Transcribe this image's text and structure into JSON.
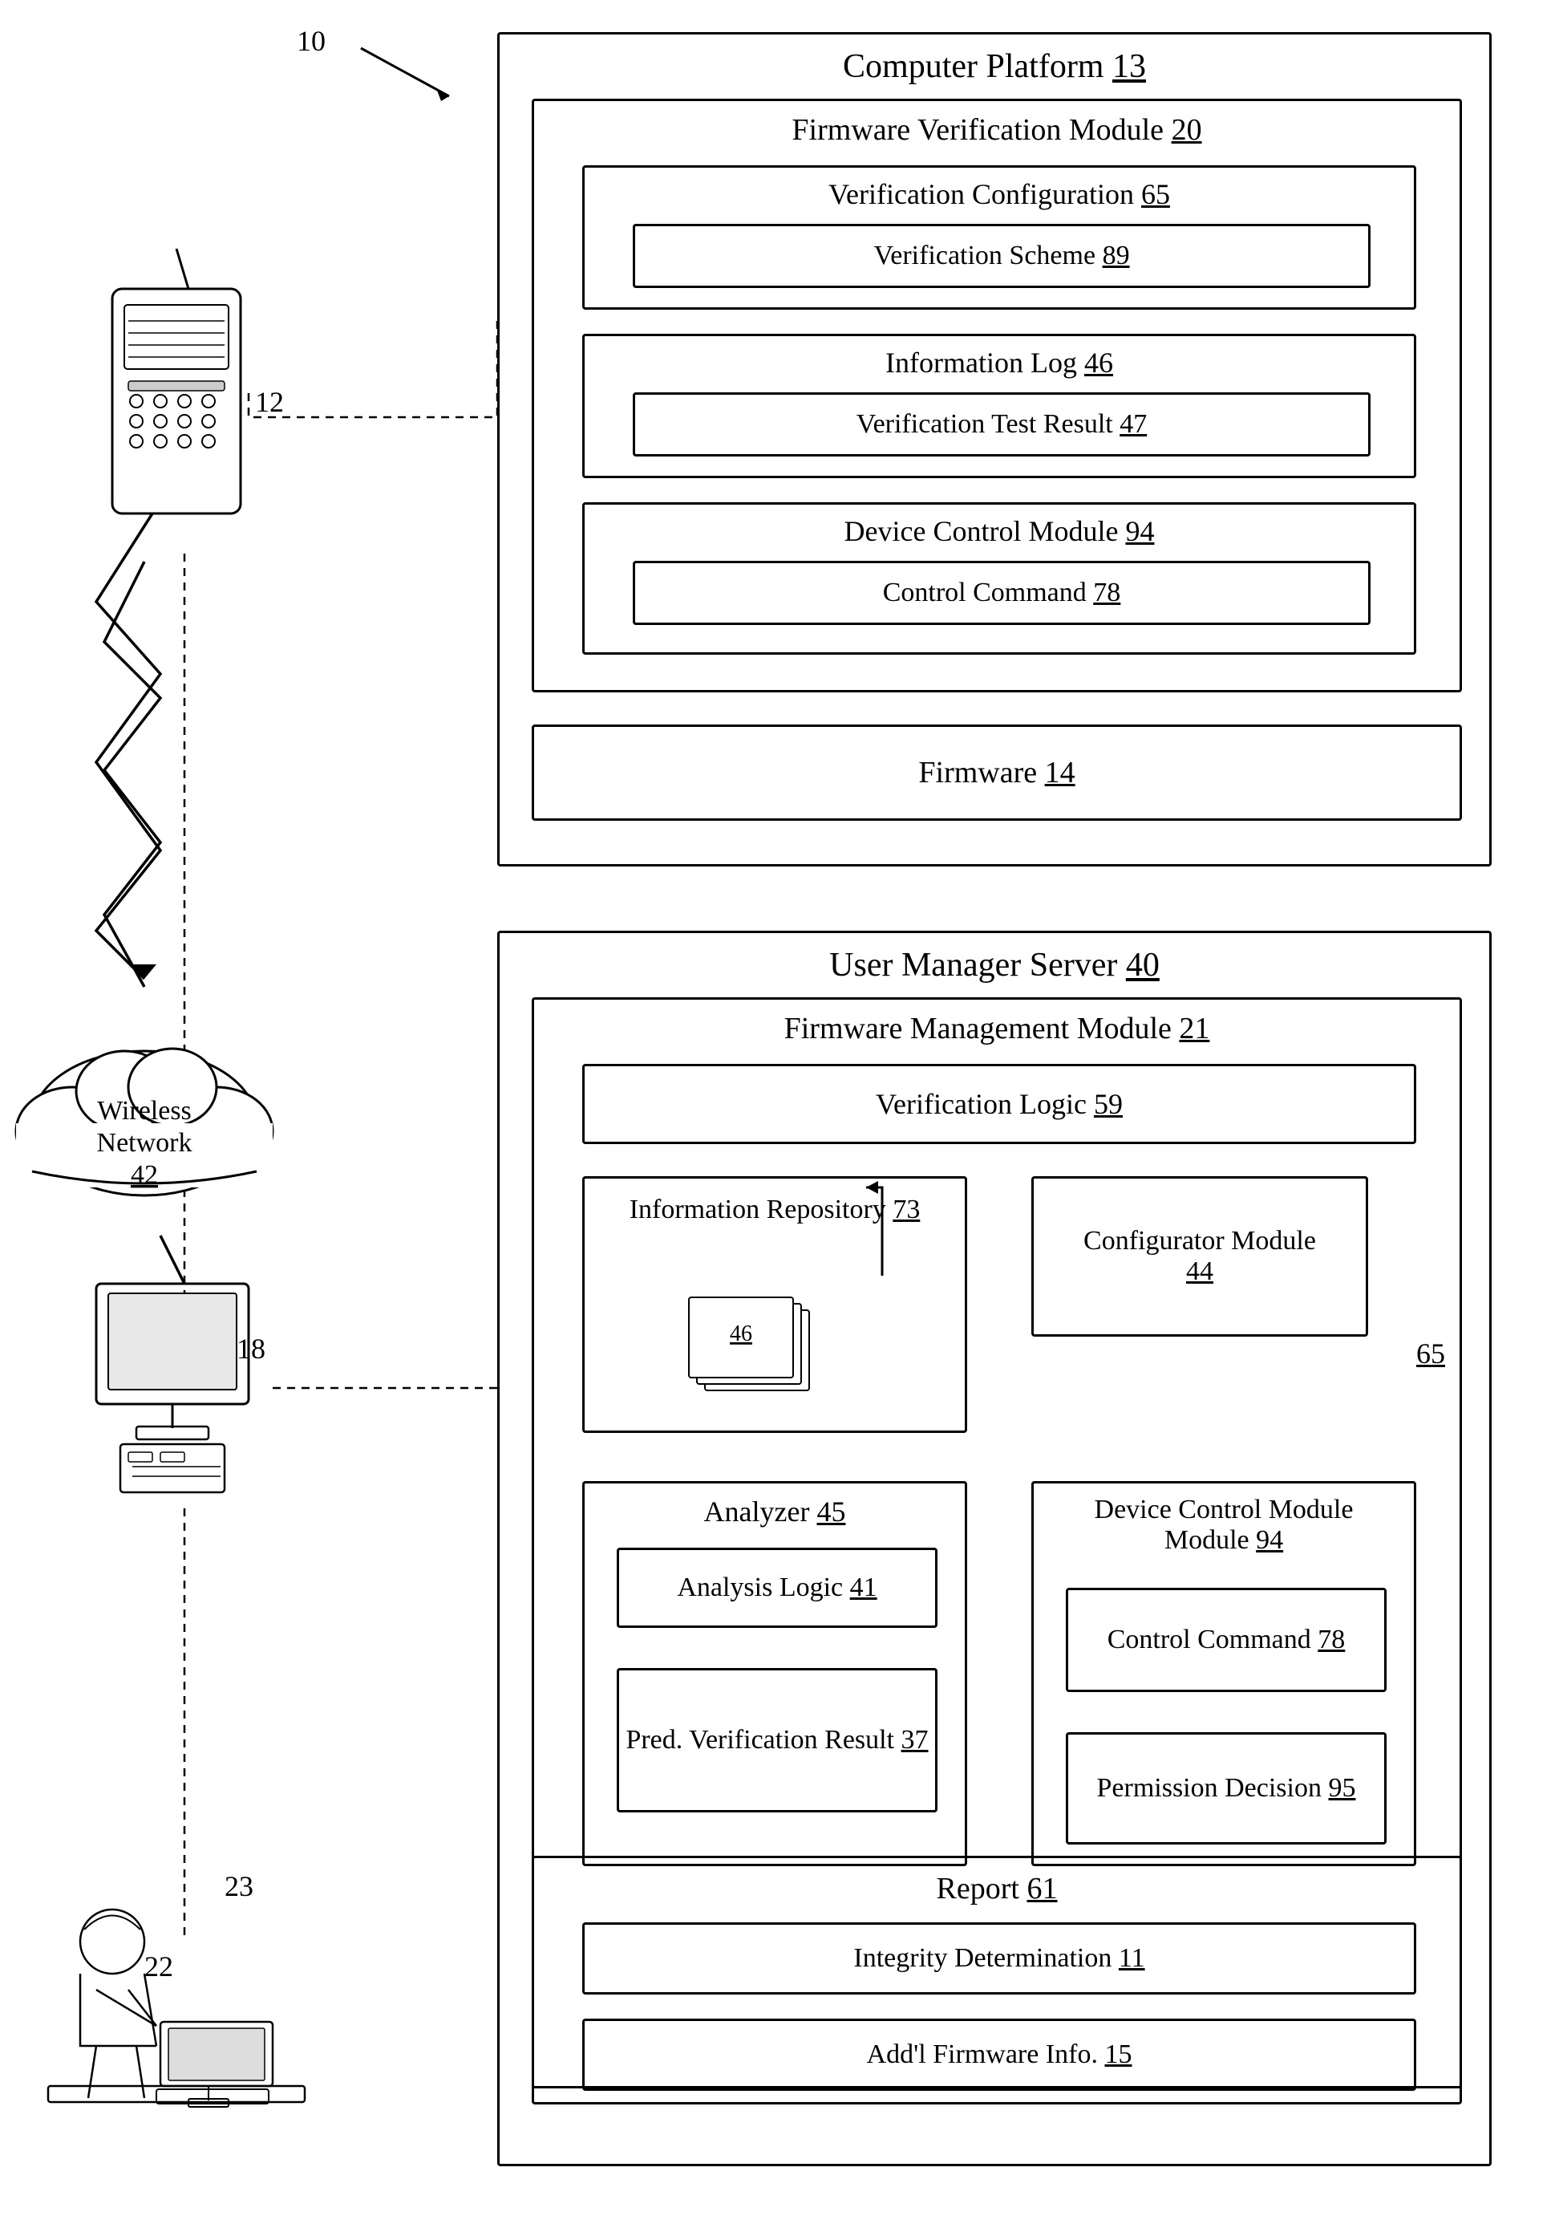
{
  "label10": "10",
  "label12": "12",
  "label18": "18",
  "label22": "22",
  "label23": "23",
  "label65_arrow": "65",
  "computer_platform": {
    "title": "Computer Platform",
    "number": "13",
    "fvm": {
      "title": "Firmware Verification Module",
      "number": "20",
      "vc": {
        "title": "Verification Configuration",
        "number": "65",
        "vs": {
          "title": "Verification Scheme",
          "number": "89"
        }
      },
      "il": {
        "title": "Information Log",
        "number": "46",
        "vtr": {
          "title": "Verification Test Result",
          "number": "47"
        }
      },
      "dcm": {
        "title": "Device Control Module",
        "number": "94",
        "cc": {
          "title": "Control Command",
          "number": "78"
        }
      }
    },
    "fw": {
      "title": "Firmware",
      "number": "14"
    }
  },
  "ums": {
    "title": "User Manager Server",
    "number": "40",
    "fmm": {
      "title": "Firmware Management Module",
      "number": "21",
      "vl": {
        "title": "Verification Logic",
        "number": "59"
      },
      "ir": {
        "title": "Information Repository",
        "number": "73",
        "page_number": "46"
      },
      "cm": {
        "title": "Configurator Module",
        "number": "44"
      },
      "analyzer": {
        "title": "Analyzer",
        "number": "45",
        "al": {
          "title": "Analysis Logic",
          "number": "41"
        },
        "pvr": {
          "title": "Pred. Verification Result",
          "number": "37"
        }
      },
      "dcm2": {
        "title": "Device Control Module",
        "number": "94",
        "cc2": {
          "title": "Control Command",
          "number": "78"
        },
        "pd": {
          "title": "Permission Decision",
          "number": "95"
        }
      }
    },
    "report": {
      "title": "Report",
      "number": "61",
      "id": {
        "title": "Integrity Determination",
        "number": "11"
      },
      "afi": {
        "title": "Add'l Firmware Info.",
        "number": "15"
      }
    }
  },
  "wireless_network": {
    "title": "Wireless",
    "title2": "Network",
    "number": "42"
  }
}
